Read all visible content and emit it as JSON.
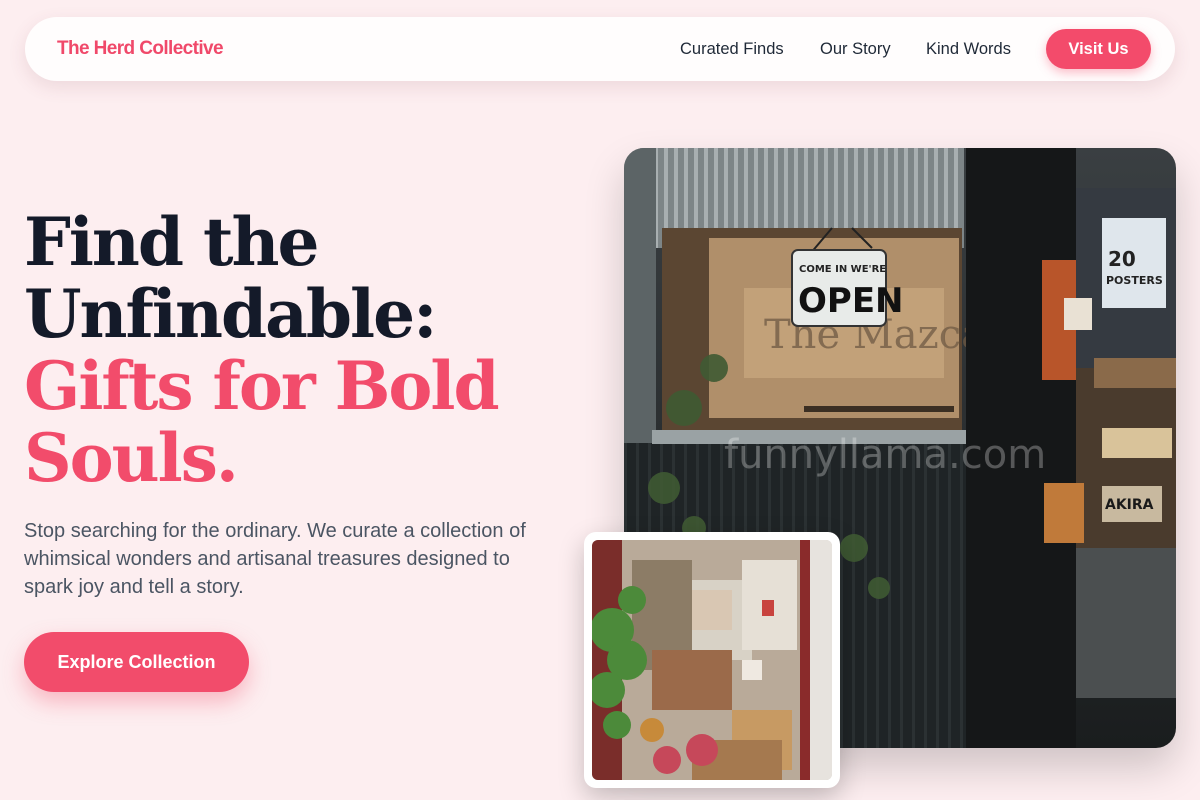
{
  "nav": {
    "brand": "The Herd Collective",
    "links": [
      "Curated Finds",
      "Our Story",
      "Kind Words"
    ],
    "cta": "Visit Us"
  },
  "hero": {
    "headline_line1": "Find the",
    "headline_line2": "Unfindable:",
    "headline_accent_line1": "Gifts for Bold",
    "headline_accent_line2": "Souls.",
    "subtitle": "Stop searching for the ordinary. We curate a collection of whimsical wonders and artisanal treasures designed to spark joy and tell a story.",
    "cta": "Explore Collection"
  },
  "main_image": {
    "sign_top": "COME IN WE'RE",
    "sign_bottom": "OPEN",
    "window_text": "The Mazcat",
    "poster_title": "POSTERS",
    "poster_number": "20",
    "poster_small": "AKIRA",
    "watermark": "funnyllama.com"
  },
  "colors": {
    "accent": "#f24c6b",
    "background": "#fdeef0",
    "heading": "#141a29",
    "body_text": "#4b5563"
  }
}
